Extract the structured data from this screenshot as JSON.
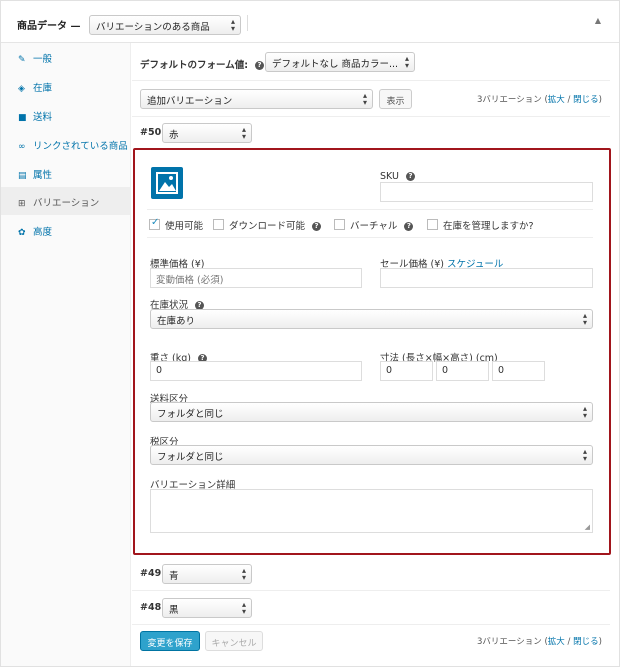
{
  "header": {
    "title": "商品データ —",
    "product_type": "バリエーションのある商品",
    "collapse_icon": "triangle-up"
  },
  "sidebar": {
    "items": [
      {
        "label": "一般",
        "icon": "wrench"
      },
      {
        "label": "在庫",
        "icon": "tag"
      },
      {
        "label": "送料",
        "icon": "truck"
      },
      {
        "label": "リンクされている商品",
        "icon": "link"
      },
      {
        "label": "属性",
        "icon": "list"
      },
      {
        "label": "バリエーション",
        "icon": "grid"
      },
      {
        "label": "高度",
        "icon": "gear"
      }
    ]
  },
  "defaults": {
    "label": "デフォルトのフォーム値:",
    "value": "デフォルトなし 商品カラー..."
  },
  "bulk": {
    "action": "追加バリエーション",
    "go_label": "表示",
    "count": "3バリエーション",
    "expand": "拡大",
    "sep": "/",
    "close": "閉じる"
  },
  "variations": [
    {
      "id": "#50",
      "value": "赤"
    },
    {
      "id": "#49",
      "value": "青"
    },
    {
      "id": "#48",
      "value": "黒"
    }
  ],
  "detail": {
    "sku_label": "SKU",
    "sku_value": "",
    "enabled_label": "使用可能",
    "downloadable_label": "ダウンロード可能",
    "virtual_label": "バーチャル",
    "manage_stock_label": "在庫を管理しますか?",
    "regular_price_label": "標準価格 (¥)",
    "regular_price_placeholder": "変動価格 (必須)",
    "sale_price_label": "セール価格 (¥)",
    "schedule_link": "スケジュール",
    "stock_status_label": "在庫状況",
    "stock_status_value": "在庫あり",
    "weight_label": "重さ (kg)",
    "weight_value": "0",
    "dimensions_label": "寸法 (長さ×幅×高さ) (cm)",
    "length_value": "0",
    "width_value": "0",
    "height_value": "0",
    "shipping_class_label": "送料区分",
    "shipping_class_value": "フォルダと同じ",
    "tax_class_label": "税区分",
    "tax_class_value": "フォルダと同じ",
    "description_label": "バリエーション詳細"
  },
  "footer": {
    "save_label": "変更を保存",
    "cancel_label": "キャンセル"
  },
  "colors": {
    "accent_border": "#a1151c",
    "link": "#0073aa",
    "primary": "#2ea2cc"
  }
}
